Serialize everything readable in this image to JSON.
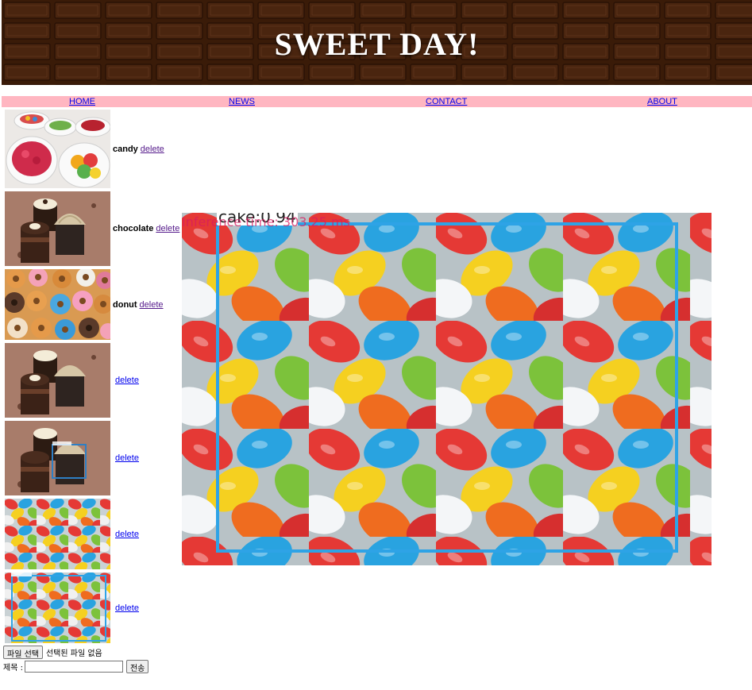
{
  "header": {
    "title": "SWEET DAY!"
  },
  "nav": {
    "items": [
      {
        "label": "HOME"
      },
      {
        "label": "NEWS"
      },
      {
        "label": "CONTACT"
      },
      {
        "label": "ABOUT"
      }
    ]
  },
  "items": [
    {
      "label": "candy",
      "delete": "delete",
      "image": "candy-bowls"
    },
    {
      "label": "chocolate",
      "delete": "delete",
      "image": "chocolate-cakes"
    },
    {
      "label": "donut",
      "delete": "delete",
      "image": "donuts"
    },
    {
      "label": "",
      "delete": "delete",
      "image": "chocolate-cakes"
    },
    {
      "label": "",
      "delete": "delete",
      "image": "chocolate-cakes-detected"
    },
    {
      "label": "",
      "delete": "delete",
      "image": "jelly-beans"
    },
    {
      "label": "",
      "delete": "delete",
      "image": "jelly-beans-detected"
    }
  ],
  "main_image": {
    "image": "jelly-beans",
    "inference_text": "Inference time: 303.25 ms",
    "detection_label": "cake:0.94",
    "box_color": "#2ea3e6"
  },
  "form": {
    "file_button": "파일 선택",
    "file_status": "선택된 파일 없음",
    "title_label": "제목 :",
    "title_value": "",
    "submit": "전송"
  },
  "colors": {
    "nav_bg": "#ffb6c1",
    "header_bg": "#3b1c0a",
    "link": "#0000ee",
    "visited": "#551a8b"
  }
}
